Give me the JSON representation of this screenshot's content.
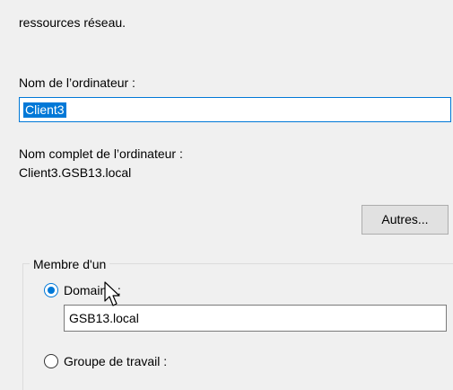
{
  "intro": {
    "text_fragment": "ressources réseau."
  },
  "computer_name": {
    "label": "Nom de l’ordinateur :",
    "value": "Client3"
  },
  "full_name": {
    "label": "Nom complet de l’ordinateur :",
    "value": "Client3.GSB13.local"
  },
  "buttons": {
    "other": "Autres..."
  },
  "member_of": {
    "legend": "Membre d'un",
    "domain": {
      "label": "Domaine :",
      "value": "GSB13.local",
      "selected": true
    },
    "workgroup": {
      "label": "Groupe de travail :",
      "selected": false
    }
  },
  "colors": {
    "accent": "#0078d7",
    "background": "#f0f0f0"
  },
  "icons": {
    "cursor": "mouse-pointer-icon"
  }
}
